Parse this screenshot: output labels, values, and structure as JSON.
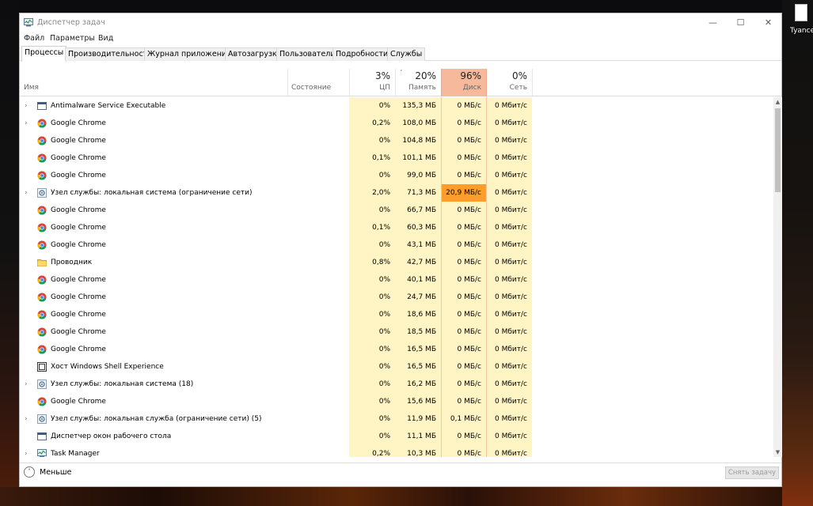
{
  "window": {
    "title": "Диспетчер задач",
    "min_glyph": "—",
    "max_glyph": "☐",
    "close_glyph": "✕"
  },
  "desktop": {
    "icon_label": "Tyance"
  },
  "menu": [
    "Файл",
    "Параметры",
    "Вид"
  ],
  "tabs": [
    "Процессы",
    "Производительность",
    "Журнал приложений",
    "Автозагрузка",
    "Пользователи",
    "Подробности",
    "Службы"
  ],
  "columns": {
    "name": "Имя",
    "status": "Состояние",
    "cpu": {
      "pct": "3%",
      "label": "ЦП"
    },
    "mem": {
      "pct": "20%",
      "label": "Память",
      "sort_glyph": "˅"
    },
    "disk": {
      "pct": "96%",
      "label": "Диск"
    },
    "net": {
      "pct": "0%",
      "label": "Сеть"
    }
  },
  "processes": [
    {
      "name": "Antimalware Service Executable",
      "icon": "service-window-icon",
      "expandable": true,
      "cpu": "0%",
      "mem": "135,3 МБ",
      "disk": "0 МБ/с",
      "net": "0 Мбит/с"
    },
    {
      "name": "Google Chrome",
      "icon": "chrome-icon",
      "expandable": true,
      "cpu": "0,2%",
      "mem": "108,0 МБ",
      "disk": "0 МБ/с",
      "net": "0 Мбит/с"
    },
    {
      "name": "Google Chrome",
      "icon": "chrome-icon",
      "expandable": false,
      "cpu": "0%",
      "mem": "104,8 МБ",
      "disk": "0 МБ/с",
      "net": "0 Мбит/с"
    },
    {
      "name": "Google Chrome",
      "icon": "chrome-icon",
      "expandable": false,
      "cpu": "0,1%",
      "mem": "101,1 МБ",
      "disk": "0 МБ/с",
      "net": "0 Мбит/с"
    },
    {
      "name": "Google Chrome",
      "icon": "chrome-icon",
      "expandable": false,
      "cpu": "0%",
      "mem": "99,0 МБ",
      "disk": "0 МБ/с",
      "net": "0 Мбит/с"
    },
    {
      "name": "Узел службы: локальная система (ограничение сети)",
      "icon": "gear-icon",
      "expandable": true,
      "cpu": "2,0%",
      "mem": "71,3 МБ",
      "disk": "20,9 МБ/с",
      "net": "0 Мбит/с",
      "hot": true
    },
    {
      "name": "Google Chrome",
      "icon": "chrome-icon",
      "expandable": false,
      "cpu": "0%",
      "mem": "66,7 МБ",
      "disk": "0 МБ/с",
      "net": "0 Мбит/с"
    },
    {
      "name": "Google Chrome",
      "icon": "chrome-icon",
      "expandable": false,
      "cpu": "0,1%",
      "mem": "60,3 МБ",
      "disk": "0 МБ/с",
      "net": "0 Мбит/с"
    },
    {
      "name": "Google Chrome",
      "icon": "chrome-icon",
      "expandable": false,
      "cpu": "0%",
      "mem": "43,1 МБ",
      "disk": "0 МБ/с",
      "net": "0 Мбит/с"
    },
    {
      "name": "Проводник",
      "icon": "folder-icon",
      "expandable": false,
      "cpu": "0,8%",
      "mem": "42,7 МБ",
      "disk": "0 МБ/с",
      "net": "0 Мбит/с"
    },
    {
      "name": "Google Chrome",
      "icon": "chrome-icon",
      "expandable": false,
      "cpu": "0%",
      "mem": "40,1 МБ",
      "disk": "0 МБ/с",
      "net": "0 Мбит/с"
    },
    {
      "name": "Google Chrome",
      "icon": "chrome-icon",
      "expandable": false,
      "cpu": "0%",
      "mem": "24,7 МБ",
      "disk": "0 МБ/с",
      "net": "0 Мбит/с"
    },
    {
      "name": "Google Chrome",
      "icon": "chrome-icon",
      "expandable": false,
      "cpu": "0%",
      "mem": "18,6 МБ",
      "disk": "0 МБ/с",
      "net": "0 Мбит/с"
    },
    {
      "name": "Google Chrome",
      "icon": "chrome-icon",
      "expandable": false,
      "cpu": "0%",
      "mem": "18,5 МБ",
      "disk": "0 МБ/с",
      "net": "0 Мбит/с"
    },
    {
      "name": "Google Chrome",
      "icon": "chrome-icon",
      "expandable": false,
      "cpu": "0%",
      "mem": "16,5 МБ",
      "disk": "0 МБ/с",
      "net": "0 Мбит/с"
    },
    {
      "name": "Хост Windows Shell Experience",
      "icon": "window-icon",
      "expandable": false,
      "cpu": "0%",
      "mem": "16,5 МБ",
      "disk": "0 МБ/с",
      "net": "0 Мбит/с"
    },
    {
      "name": "Узел службы: локальная система (18)",
      "icon": "gear-icon",
      "expandable": true,
      "cpu": "0%",
      "mem": "16,2 МБ",
      "disk": "0 МБ/с",
      "net": "0 Мбит/с"
    },
    {
      "name": "Google Chrome",
      "icon": "chrome-icon",
      "expandable": false,
      "cpu": "0%",
      "mem": "15,6 МБ",
      "disk": "0 МБ/с",
      "net": "0 Мбит/с"
    },
    {
      "name": "Узел службы: локальная служба (ограничение сети) (5)",
      "icon": "gear-icon",
      "expandable": true,
      "cpu": "0%",
      "mem": "11,9 МБ",
      "disk": "0,1 МБ/с",
      "net": "0 Мбит/с"
    },
    {
      "name": "Диспетчер окон рабочего стола",
      "icon": "service-window-icon",
      "expandable": false,
      "cpu": "0%",
      "mem": "11,1 МБ",
      "disk": "0 МБ/с",
      "net": "0 Мбит/с"
    },
    {
      "name": "Task Manager",
      "icon": "task-manager-icon",
      "expandable": true,
      "cpu": "0,2%",
      "mem": "10,3 МБ",
      "disk": "0 МБ/с",
      "net": "0 Мбит/с"
    }
  ],
  "footer": {
    "less_label": "Меньше",
    "less_glyph": "˄",
    "end_task_label": "Снять задачу"
  },
  "colors": {
    "column_bg": "#fff4c4",
    "disk_header_bg": "#f7b99b",
    "disk_hot_bg": "#ff9d2a"
  }
}
